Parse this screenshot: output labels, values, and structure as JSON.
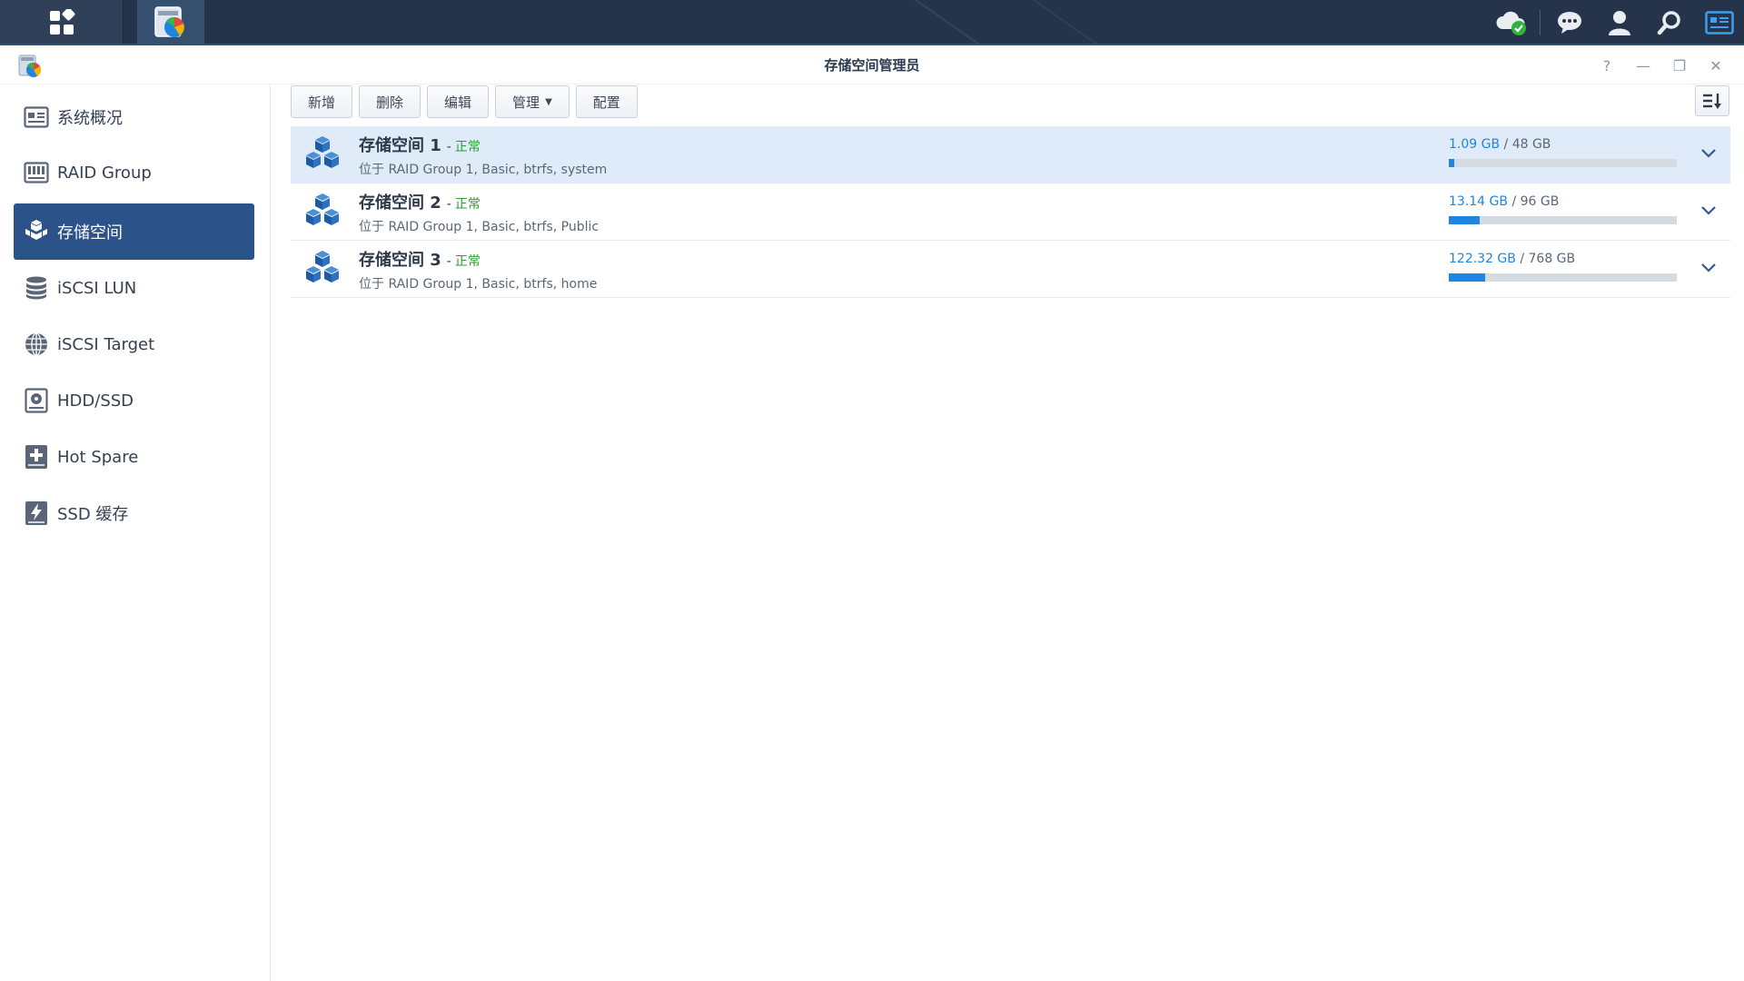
{
  "taskbar": {
    "main_menu_icon": "grid-apps-icon",
    "active_app_icon": "storage-manager-app-icon",
    "right_icons": [
      "cloud-check-icon",
      "chat-icon",
      "user-icon",
      "search-icon",
      "widgets-icon"
    ]
  },
  "window": {
    "title": "存储空间管理员",
    "controls": {
      "help": "?",
      "minimize": "—",
      "restore": "❐",
      "close": "✕"
    }
  },
  "sidebar": {
    "items": [
      {
        "label": "系统概况",
        "icon": "overview-icon",
        "active": false
      },
      {
        "label": "RAID Group",
        "icon": "raid-group-icon",
        "active": false
      },
      {
        "label": "存储空间",
        "icon": "volume-icon",
        "active": true
      },
      {
        "label": "iSCSI LUN",
        "icon": "iscsi-lun-icon",
        "active": false
      },
      {
        "label": "iSCSI Target",
        "icon": "iscsi-target-icon",
        "active": false
      },
      {
        "label": "HDD/SSD",
        "icon": "hdd-icon",
        "active": false
      },
      {
        "label": "Hot Spare",
        "icon": "hot-spare-icon",
        "active": false
      },
      {
        "label": "SSD 缓存",
        "icon": "ssd-cache-icon",
        "active": false
      }
    ]
  },
  "toolbar": {
    "create": "新增",
    "delete": "删除",
    "edit": "编辑",
    "manage": "管理",
    "configure": "配置"
  },
  "volumes": [
    {
      "name": "存储空间 1",
      "sep": "-",
      "status": "正常",
      "desc": "位于 RAID Group 1, Basic, btrfs, system",
      "used": "1.09 GB",
      "total": "/ 48 GB",
      "fraction": 0.023,
      "selected": true
    },
    {
      "name": "存储空间 2",
      "sep": "-",
      "status": "正常",
      "desc": "位于 RAID Group 1, Basic, btrfs, Public",
      "used": "13.14 GB",
      "total": "/ 96 GB",
      "fraction": 0.137,
      "selected": false
    },
    {
      "name": "存储空间 3",
      "sep": "-",
      "status": "正常",
      "desc": "位于 RAID Group 1, Basic, btrfs, home",
      "used": "122.32 GB",
      "total": "/ 768 GB",
      "fraction": 0.159,
      "selected": false
    }
  ],
  "colors": {
    "taskbar": "#25344a",
    "active_nav": "#2b5389",
    "accent": "#1e86e0",
    "status_ok": "#24a12e",
    "selected_row": "#dfebf9"
  }
}
